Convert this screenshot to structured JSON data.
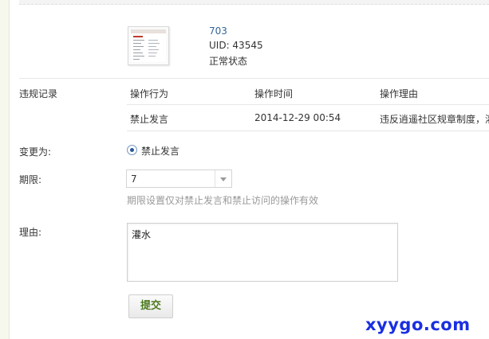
{
  "user": {
    "name": "703",
    "uid": "UID: 43545",
    "status": "正常状态"
  },
  "records": {
    "label": "违规记录",
    "headers": [
      "操作行为",
      "操作时间",
      "操作理由"
    ],
    "rows": [
      {
        "action": "禁止发言",
        "time": "2014-12-29 00:54",
        "reason": "违反逍遥社区规章制度，灌"
      }
    ]
  },
  "change_to": {
    "label": "变更为:",
    "option": "禁止发言",
    "checked": true
  },
  "period": {
    "label": "期限:",
    "value": "7",
    "hint": "期限设置仅对禁止发言和禁止访问的操作有效"
  },
  "reason": {
    "label": "理由:",
    "value": "灌水"
  },
  "submit_label": "提交",
  "watermark": "xyygo.com",
  "colors": {
    "link": "#336699",
    "submit_text": "#4c7a1e",
    "watermark": "#1a2fe0",
    "radio_dot": "#2b5797"
  },
  "icons": {
    "avatar": "avatar-thumbnail",
    "select_arrow": "chevron-down-icon",
    "radio": "radio-checked-icon"
  }
}
